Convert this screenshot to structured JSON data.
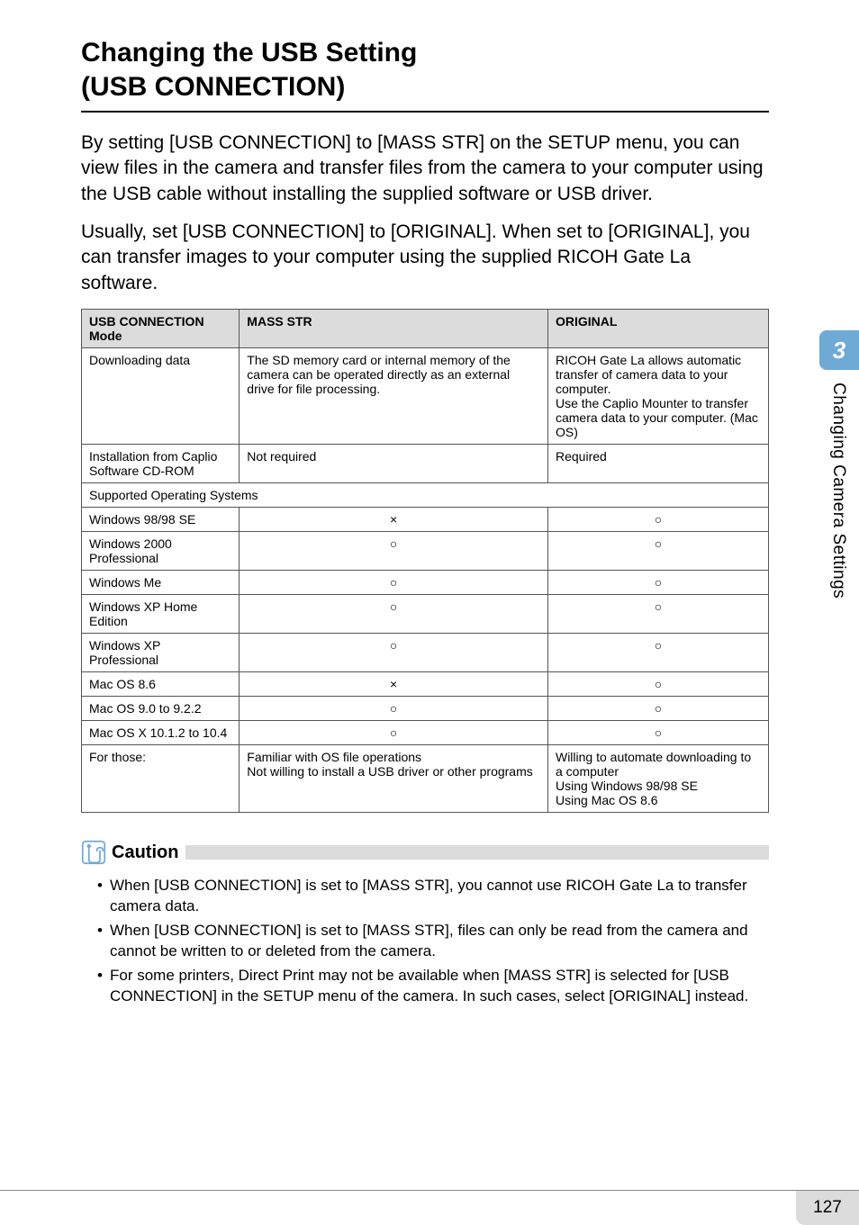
{
  "title_line1": "Changing the USB Setting",
  "title_line2": "(USB CONNECTION)",
  "intro1": "By setting [USB CONNECTION] to [MASS STR] on the SETUP menu, you can view files in the camera and transfer files from the camera to your computer using the USB cable without installing the supplied software or USB driver.",
  "intro2": "Usually, set [USB CONNECTION] to [ORIGINAL]. When set to [ORIGINAL], you can transfer images to your computer using the supplied RICOH Gate La software.",
  "table": {
    "headers": {
      "col1": "USB CONNECTION Mode",
      "col2": "MASS STR",
      "col3": "ORIGINAL"
    },
    "rows": {
      "downloading": {
        "c1": "Downloading data",
        "c2": "The SD memory card or internal memory of the camera can be operated directly as an external drive for file processing.",
        "c3": "RICOH Gate La allows automatic transfer of camera data to your computer.\nUse the Caplio Mounter to transfer camera data to your computer. (Mac OS)"
      },
      "install": {
        "c1": "Installation from Caplio Software CD-ROM",
        "c2": "Not required",
        "c3": "Required"
      },
      "supported_header": "Supported Operating Systems",
      "os": [
        {
          "name": "Windows 98/98 SE",
          "m": "×",
          "o": "○"
        },
        {
          "name": "Windows 2000 Professional",
          "m": "○",
          "o": "○"
        },
        {
          "name": "Windows Me",
          "m": "○",
          "o": "○"
        },
        {
          "name": "Windows XP Home Edition",
          "m": "○",
          "o": "○"
        },
        {
          "name": "Windows XP Professional",
          "m": "○",
          "o": "○"
        },
        {
          "name": "Mac OS 8.6",
          "m": "×",
          "o": "○"
        },
        {
          "name": "Mac OS 9.0 to 9.2.2",
          "m": "○",
          "o": "○"
        },
        {
          "name": "Mac OS X 10.1.2 to 10.4",
          "m": "○",
          "o": "○"
        }
      ],
      "for_those": {
        "c1": "For those:",
        "c2": "Familiar with OS file operations\nNot willing to install a USB driver or other programs",
        "c3": "Willing to automate downloading to a computer\nUsing Windows 98/98 SE\nUsing Mac OS 8.6"
      }
    }
  },
  "caution": {
    "label": "Caution",
    "items": [
      "When [USB CONNECTION] is set to [MASS STR], you cannot use RICOH Gate La to transfer camera data.",
      "When [USB CONNECTION] is set to [MASS STR], files can only be read from the camera and cannot be written to or deleted from the camera.",
      "For some printers, Direct Print may not be available when [MASS STR] is selected for [USB CONNECTION] in the SETUP menu of the camera. In such cases, select [ORIGINAL] instead."
    ]
  },
  "sidebar": {
    "chapter_number": "3",
    "chapter_title": "Changing Camera Settings"
  },
  "page_number": "127"
}
